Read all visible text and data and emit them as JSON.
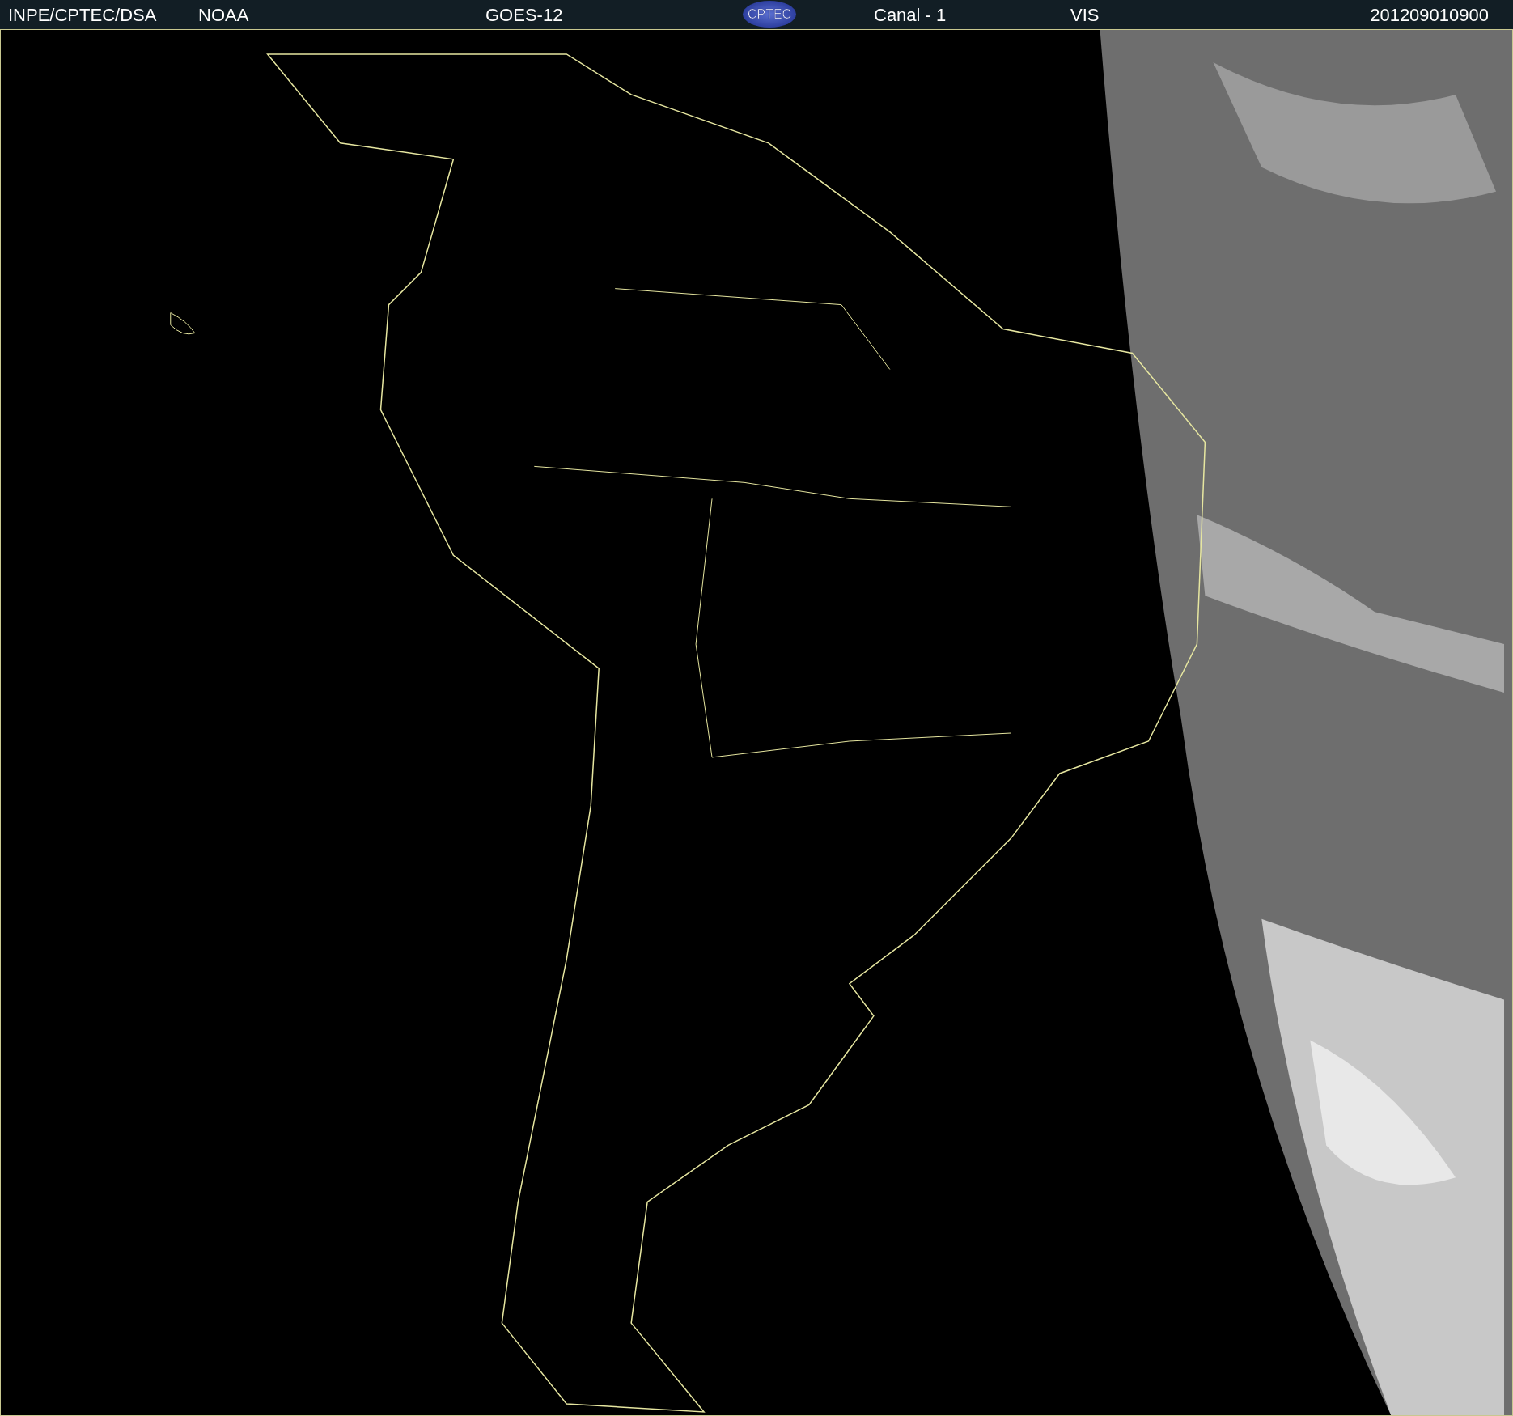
{
  "header": {
    "source": "INPE/CPTEC/DSA",
    "agency": "NOAA",
    "satellite": "GOES-12",
    "logo_text": "CPTEC",
    "channel": "Canal - 1",
    "band": "VIS",
    "timestamp": "201209010900"
  }
}
